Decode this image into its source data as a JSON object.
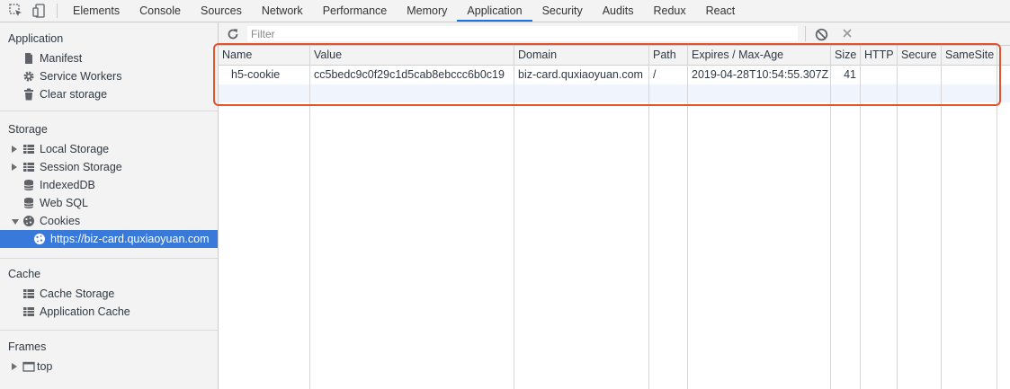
{
  "toolbar": {
    "inspect_icon": "inspect-element-icon",
    "device_icon": "device-toolbar-icon"
  },
  "tabs": [
    {
      "label": "Elements",
      "active": false
    },
    {
      "label": "Console",
      "active": false
    },
    {
      "label": "Sources",
      "active": false
    },
    {
      "label": "Network",
      "active": false
    },
    {
      "label": "Performance",
      "active": false
    },
    {
      "label": "Memory",
      "active": false
    },
    {
      "label": "Application",
      "active": true
    },
    {
      "label": "Security",
      "active": false
    },
    {
      "label": "Audits",
      "active": false
    },
    {
      "label": "Redux",
      "active": false
    },
    {
      "label": "React",
      "active": false
    }
  ],
  "sidebar": {
    "application": {
      "heading": "Application",
      "items": [
        {
          "label": "Manifest",
          "icon": "document-icon"
        },
        {
          "label": "Service Workers",
          "icon": "gear-icon"
        },
        {
          "label": "Clear storage",
          "icon": "trash-icon"
        }
      ]
    },
    "storage": {
      "heading": "Storage",
      "items": [
        {
          "label": "Local Storage",
          "icon": "grid-icon",
          "arrow": "collapsed"
        },
        {
          "label": "Session Storage",
          "icon": "grid-icon",
          "arrow": "collapsed"
        },
        {
          "label": "IndexedDB",
          "icon": "database-icon"
        },
        {
          "label": "Web SQL",
          "icon": "database-icon"
        },
        {
          "label": "Cookies",
          "icon": "cookie-icon",
          "arrow": "expanded"
        },
        {
          "label": "https://biz-card.quxiaoyuan.com",
          "icon": "cookie-icon",
          "selected": true
        }
      ]
    },
    "cache": {
      "heading": "Cache",
      "items": [
        {
          "label": "Cache Storage",
          "icon": "grid-icon"
        },
        {
          "label": "Application Cache",
          "icon": "grid-icon"
        }
      ]
    },
    "frames": {
      "heading": "Frames",
      "items": [
        {
          "label": "top",
          "icon": "frame-icon",
          "arrow": "collapsed"
        }
      ]
    }
  },
  "filter": {
    "placeholder": "Filter",
    "value": ""
  },
  "cookies": {
    "columns": [
      "Name",
      "Value",
      "Domain",
      "Path",
      "Expires / Max-Age",
      "Size",
      "HTTP",
      "Secure",
      "SameSite"
    ],
    "rows": [
      {
        "name": "h5-cookie",
        "value": "cc5bedc9c0f29c1d5cab8ebccc6b0c19",
        "domain": "biz-card.quxiaoyuan.com",
        "path": "/",
        "expires": "2019-04-28T10:54:55.307Z",
        "size": "41",
        "http": "",
        "secure": "",
        "samesite": ""
      }
    ]
  },
  "colors": {
    "accent": "#1a73e8",
    "selected_row": "#3879d9",
    "highlight_box": "#e5532c"
  }
}
